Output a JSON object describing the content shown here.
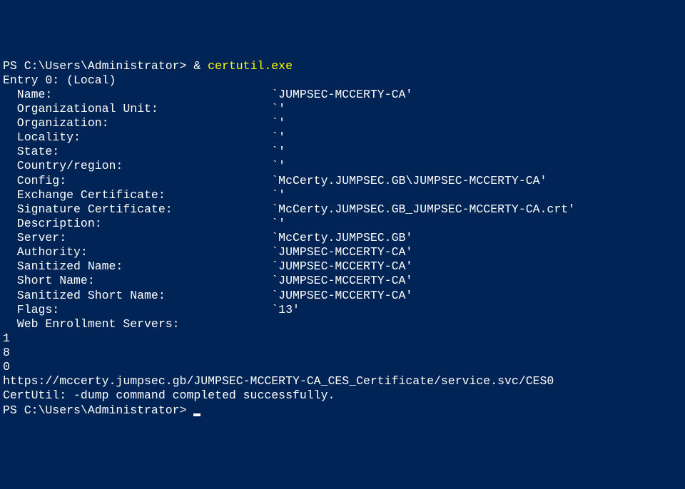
{
  "prompt1": {
    "prefix": "PS C:\\Users\\Administrator> ",
    "amp": "& ",
    "command": "certutil.exe"
  },
  "output": {
    "entry_header": "Entry 0: (Local)",
    "rows": [
      {
        "label": "  Name:",
        "value": "`JUMPSEC-MCCERTY-CA'"
      },
      {
        "label": "  Organizational Unit:",
        "value": "`'"
      },
      {
        "label": "  Organization:",
        "value": "`'"
      },
      {
        "label": "  Locality:",
        "value": "`'"
      },
      {
        "label": "  State:",
        "value": "`'"
      },
      {
        "label": "  Country/region:",
        "value": "`'"
      },
      {
        "label": "  Config:",
        "value": "`McCerty.JUMPSEC.GB\\JUMPSEC-MCCERTY-CA'"
      },
      {
        "label": "  Exchange Certificate:",
        "value": "`'"
      },
      {
        "label": "  Signature Certificate:",
        "value": "`McCerty.JUMPSEC.GB_JUMPSEC-MCCERTY-CA.crt'"
      },
      {
        "label": "  Description:",
        "value": "`'"
      },
      {
        "label": "  Server:",
        "value": "`McCerty.JUMPSEC.GB'"
      },
      {
        "label": "  Authority:",
        "value": "`JUMPSEC-MCCERTY-CA'"
      },
      {
        "label": "  Sanitized Name:",
        "value": "`JUMPSEC-MCCERTY-CA'"
      },
      {
        "label": "  Short Name:",
        "value": "`JUMPSEC-MCCERTY-CA'"
      },
      {
        "label": "  Sanitized Short Name:",
        "value": "`JUMPSEC-MCCERTY-CA'"
      },
      {
        "label": "  Flags:",
        "value": "`13'"
      },
      {
        "label": "  Web Enrollment Servers:",
        "value": ""
      }
    ],
    "tail": [
      "1",
      "8",
      "0",
      "https://mccerty.jumpsec.gb/JUMPSEC-MCCERTY-CA_CES_Certificate/service.svc/CES0",
      "CertUtil: -dump command completed successfully."
    ]
  },
  "prompt2": {
    "prefix": "PS C:\\Users\\Administrator> "
  }
}
